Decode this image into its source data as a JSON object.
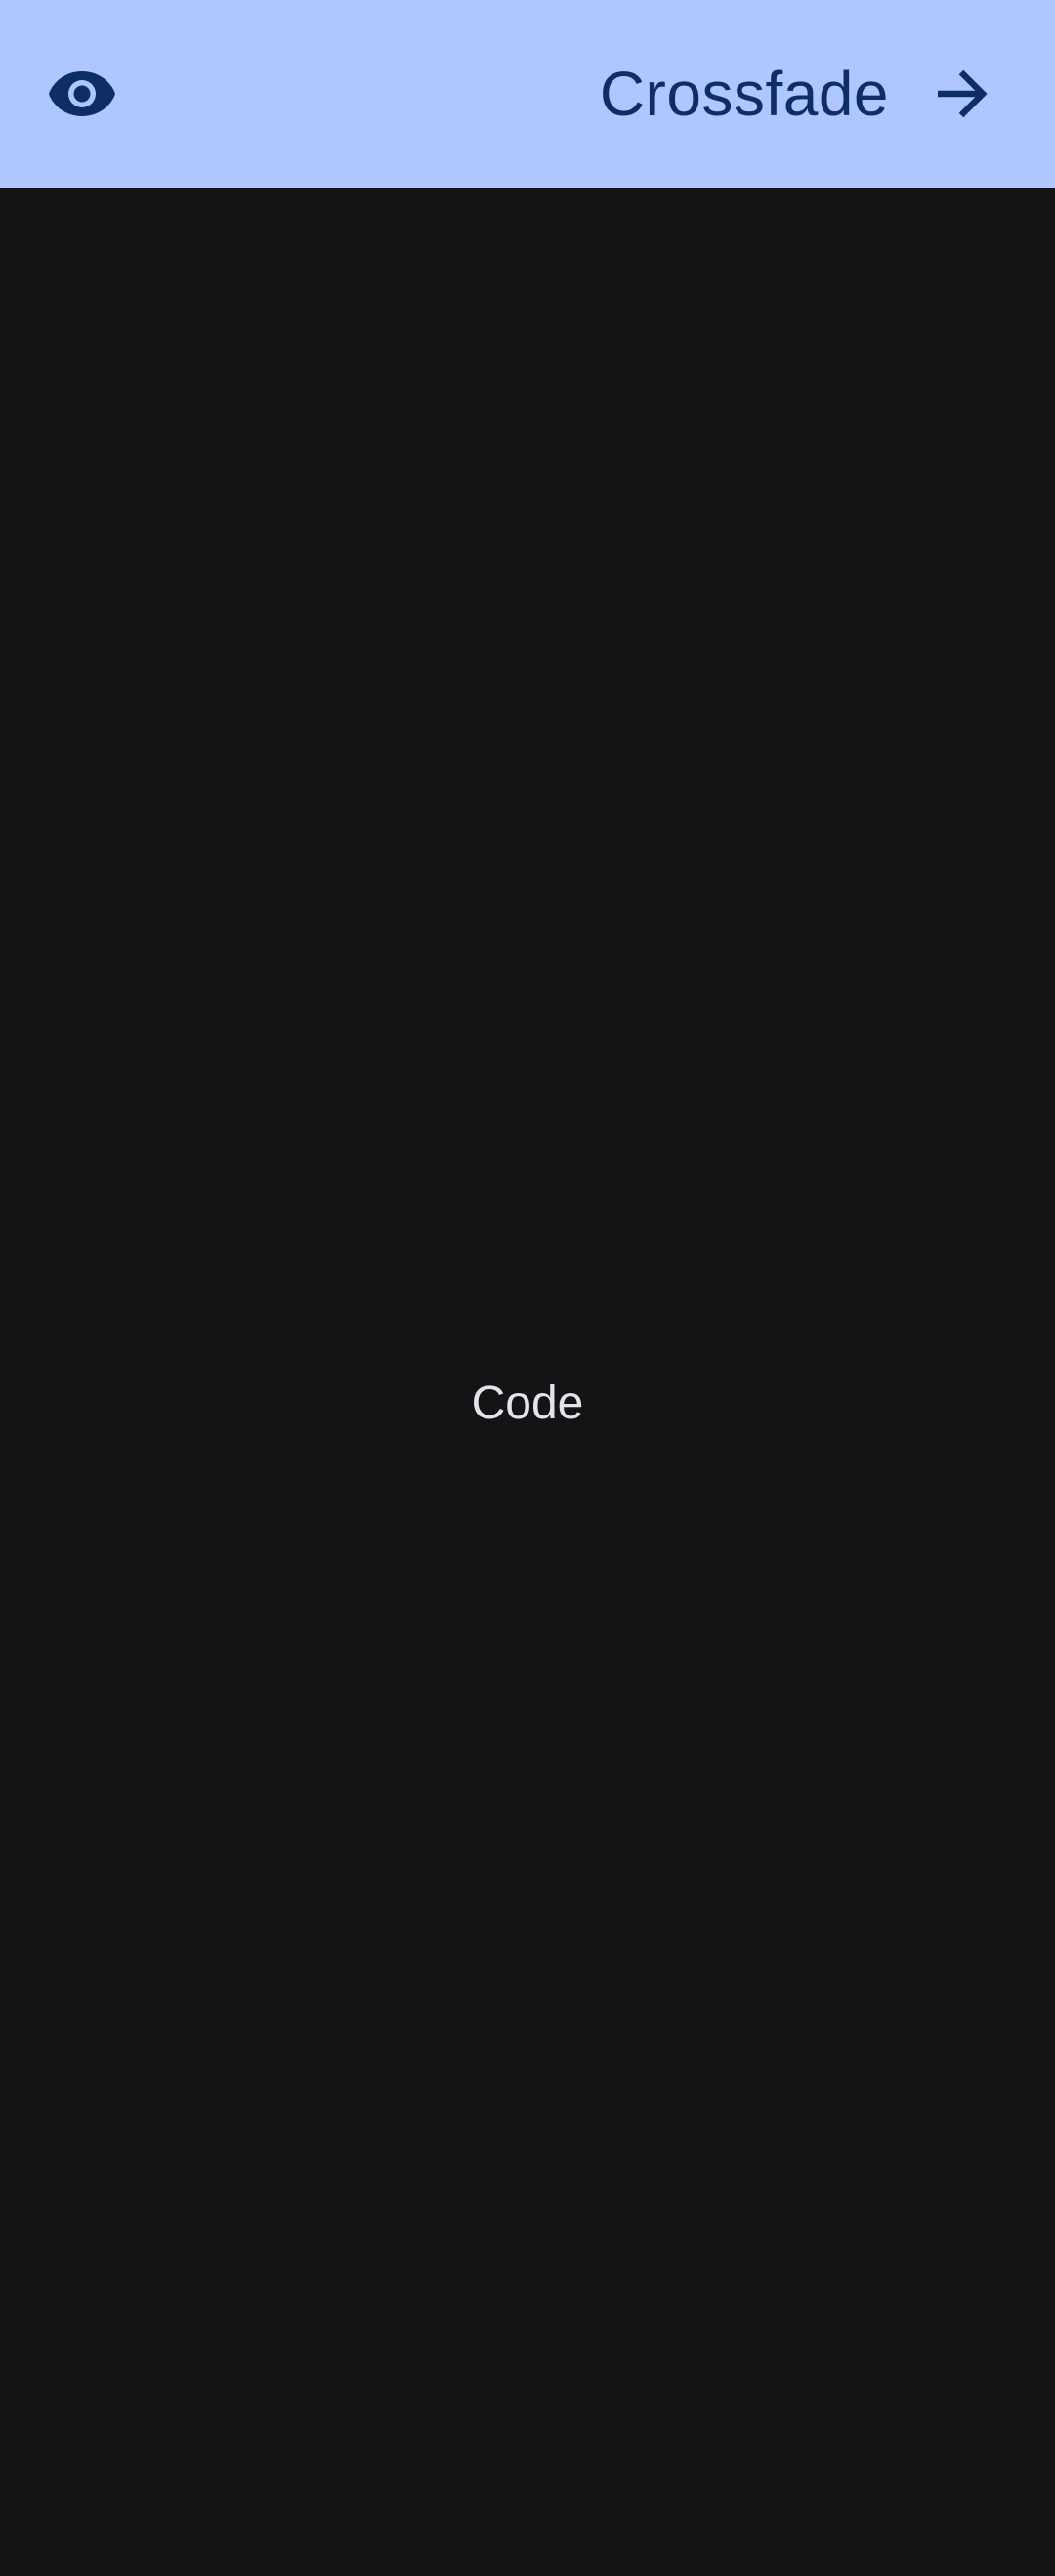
{
  "app_bar": {
    "title": "Crossfade",
    "leading_icon": "eye-icon",
    "trailing_icon": "arrow-forward-icon",
    "background": "#AFC6FF",
    "foreground": "#0F2E63"
  },
  "content": {
    "label": "Code",
    "background": "#131416",
    "text_color": "#E4E4E8"
  }
}
